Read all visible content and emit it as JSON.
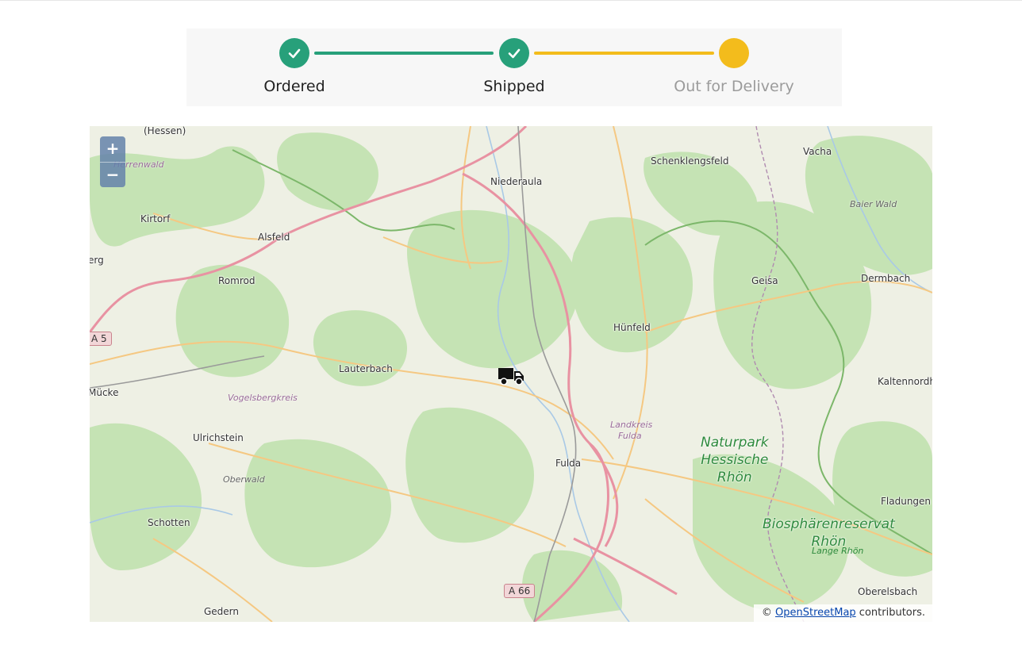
{
  "tracker": {
    "steps": [
      {
        "label": "Ordered",
        "status": "done"
      },
      {
        "label": "Shipped",
        "status": "done"
      },
      {
        "label": "Out for Delivery",
        "status": "current"
      }
    ],
    "colors": {
      "done": "#27a07a",
      "current": "#f3bc1c",
      "pending_text": "#9b9b9b"
    }
  },
  "map": {
    "zoom_in_label": "+",
    "zoom_out_label": "−",
    "marker_icon": "truck-icon",
    "places": {
      "hessen": "(Hessen)",
      "herrenwald": "Herrenwald",
      "niederaula": "Niederaula",
      "schenklengsfeld": "Schenklengsfeld",
      "vacha": "Vacha",
      "kirtorf": "Kirtorf",
      "alsfeld": "Alsfeld",
      "baier_wald": "Baier Wald",
      "erg": "erg",
      "romrod": "Romrod",
      "geisa": "Geisa",
      "dermbach": "Dermbach",
      "huenfeld": "Hünfeld",
      "lauterbach": "Lauterbach",
      "kaltennordheim": "Kaltennordh",
      "muecke": "Mücke",
      "vogelsbergkreis": "Vogelsbergkreis",
      "landkreis": "Landkreis",
      "fulda_kreis": "Fulda",
      "ulrichstein": "Ulrichstein",
      "fulda": "Fulda",
      "oberwald": "Oberwald",
      "fladungen": "Fladungen",
      "schotten": "Schotten",
      "rhoen": "Rhön",
      "lange_rhoen": "Lange Rhön",
      "oberelsbach": "Oberelsbach",
      "gedern": "Gedern"
    },
    "parks": {
      "naturpark": [
        "Naturpark",
        "Hessische",
        "Rhön"
      ],
      "biosphaere": "Biosphärenreservat"
    },
    "shields": {
      "a5": "A 5",
      "a66": "A 66"
    },
    "attribution": {
      "prefix": "© ",
      "link": "OpenStreetMap",
      "suffix": " contributors."
    }
  }
}
